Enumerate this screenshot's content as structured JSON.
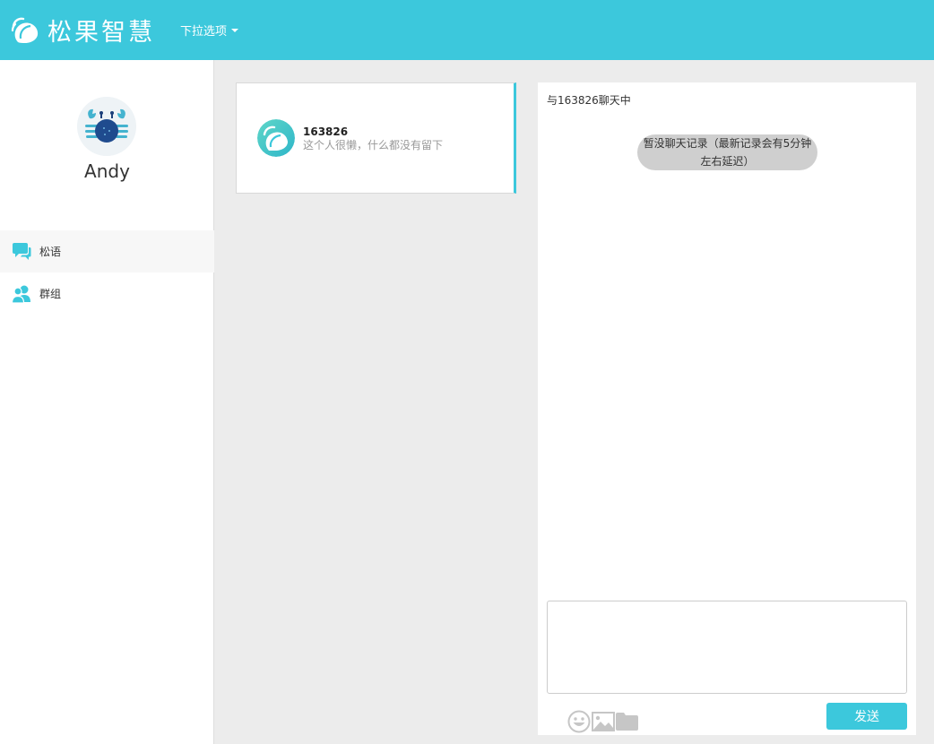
{
  "brand": {
    "name": "松果智慧",
    "color": "#3cc8dc"
  },
  "header": {
    "dropdown_label": "下拉选项"
  },
  "user": {
    "name": "Andy",
    "avatar_icon": "crab-icon"
  },
  "nav": [
    {
      "label": "松语",
      "icon": "chat-bubble-icon",
      "active": true
    },
    {
      "label": "群组",
      "icon": "group-icon",
      "active": false
    }
  ],
  "contacts": [
    {
      "name": "163826",
      "signature": "这个人很懒，什么都没有留下",
      "icon": "pinecone-logo-icon"
    }
  ],
  "chat": {
    "title": "与163826聊天中",
    "empty_notice": "暂没聊天记录（最新记录会有5分钟左右延迟）",
    "input_value": "",
    "send_label": "发送",
    "tools": [
      "emoji-icon",
      "image-icon",
      "folder-icon"
    ]
  }
}
